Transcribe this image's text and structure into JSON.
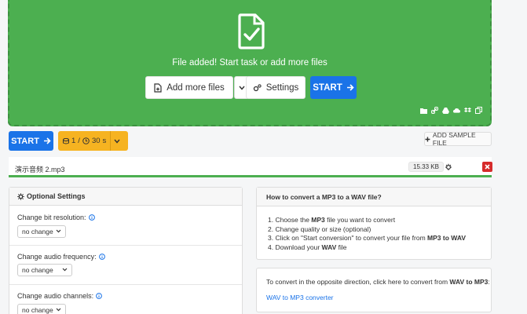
{
  "dropzone": {
    "message": "File added! Start task or add more files",
    "add_more_label": "Add more files",
    "settings_label": "Settings",
    "start_label": "START",
    "cloud_icons": [
      "folder-icon",
      "link-icon",
      "google-drive-icon",
      "cloud-icon",
      "dropbox-icon",
      "copy-icon"
    ],
    "color": "#4caf50"
  },
  "toolbar": {
    "start_label": "START",
    "limit_count": "1",
    "limit_sep": "/",
    "limit_time": "30",
    "limit_unit": "s",
    "add_sample_label": "ADD SAMPLE FILE"
  },
  "file": {
    "name": "演示音频 2.mp3",
    "size": "15.33 KB"
  },
  "optional_settings": {
    "title": "Optional Settings",
    "fields": [
      {
        "label": "Change bit resolution:",
        "value": "no change"
      },
      {
        "label": "Change audio frequency:",
        "value": "no change"
      },
      {
        "label": "Change audio channels:",
        "value": "no change"
      }
    ]
  },
  "howto": {
    "title": "How to convert a MP3 to a WAV file?",
    "steps": [
      {
        "p1": "1. Choose the ",
        "b1": "MP3",
        "p2": " file you want to convert",
        "b2": "",
        "p3": ""
      },
      {
        "p1": "2. Change quality or size (optional)",
        "b1": "",
        "p2": "",
        "b2": "",
        "p3": ""
      },
      {
        "p1": "3. Click on \"Start conversion\" to convert your file from ",
        "b1": "MP3",
        "p2": " to ",
        "b2": "WAV",
        "p3": ""
      },
      {
        "p1": "4. Download your ",
        "b1": "WAV",
        "p2": " file",
        "b2": "",
        "p3": ""
      }
    ]
  },
  "opposite": {
    "text_prefix": "To convert in the opposite direction, click here to convert from ",
    "from": "WAV",
    "to_word": " to ",
    "to": "MP3",
    "suffix": ":",
    "link": "WAV to MP3 converter"
  },
  "colors": {
    "accent_blue": "#1a73e8",
    "limit_orange": "#f6b321",
    "delete_red": "#d62b2b"
  }
}
